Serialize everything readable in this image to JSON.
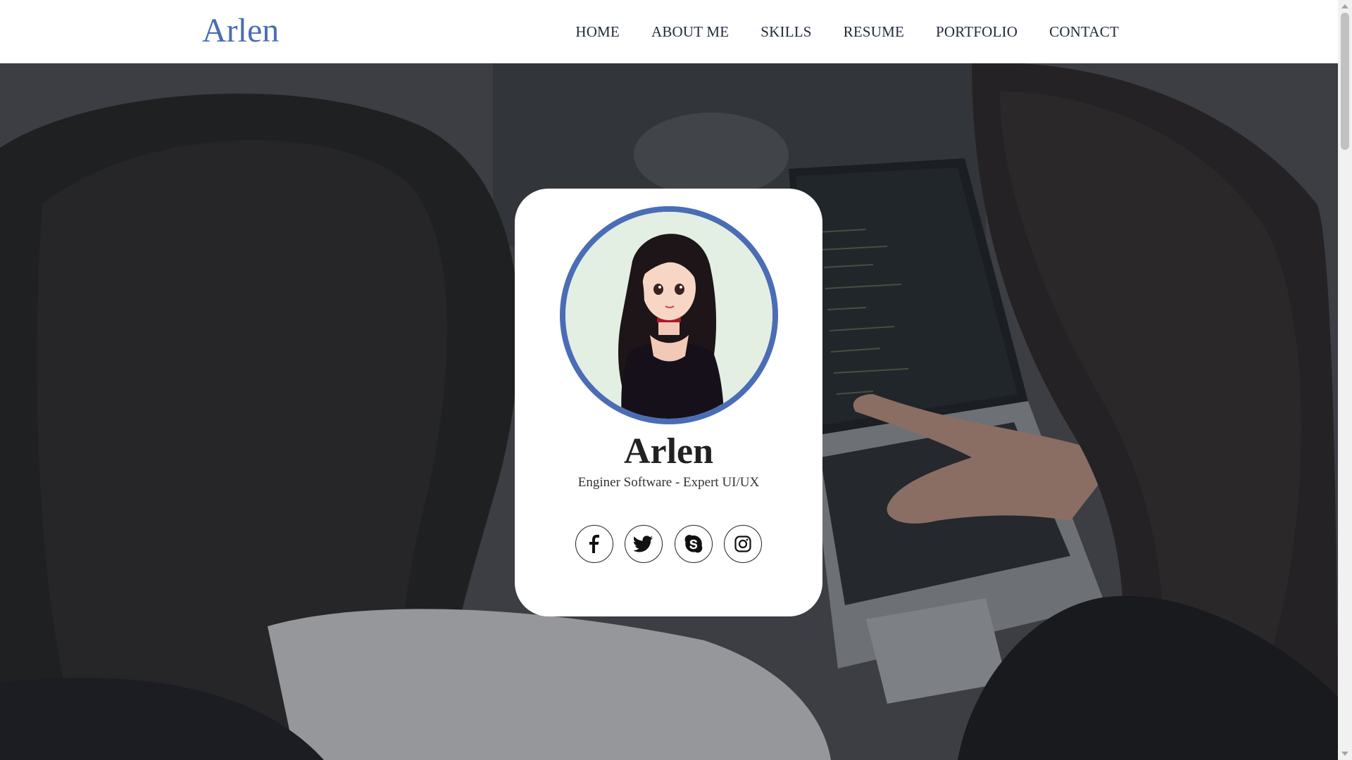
{
  "navbar": {
    "brand": "Arlen",
    "links": [
      {
        "label": "HOME"
      },
      {
        "label": "ABOUT ME"
      },
      {
        "label": "SKILLS"
      },
      {
        "label": "RESUME"
      },
      {
        "label": "PORTFOLIO"
      },
      {
        "label": "CONTACT"
      }
    ]
  },
  "profile": {
    "name": "Arlen",
    "role": "Enginer Software - Expert UI/UX",
    "avatar_icon": "anime-girl-avatar",
    "socials": [
      {
        "icon": "facebook-icon"
      },
      {
        "icon": "twitter-icon"
      },
      {
        "icon": "skype-icon"
      },
      {
        "icon": "instagram-icon"
      }
    ]
  },
  "colors": {
    "accent": "#4a6db5",
    "card_bg": "#ffffff",
    "nav_text": "#1f2a3a",
    "avatar_bg": "#e4efe3"
  }
}
